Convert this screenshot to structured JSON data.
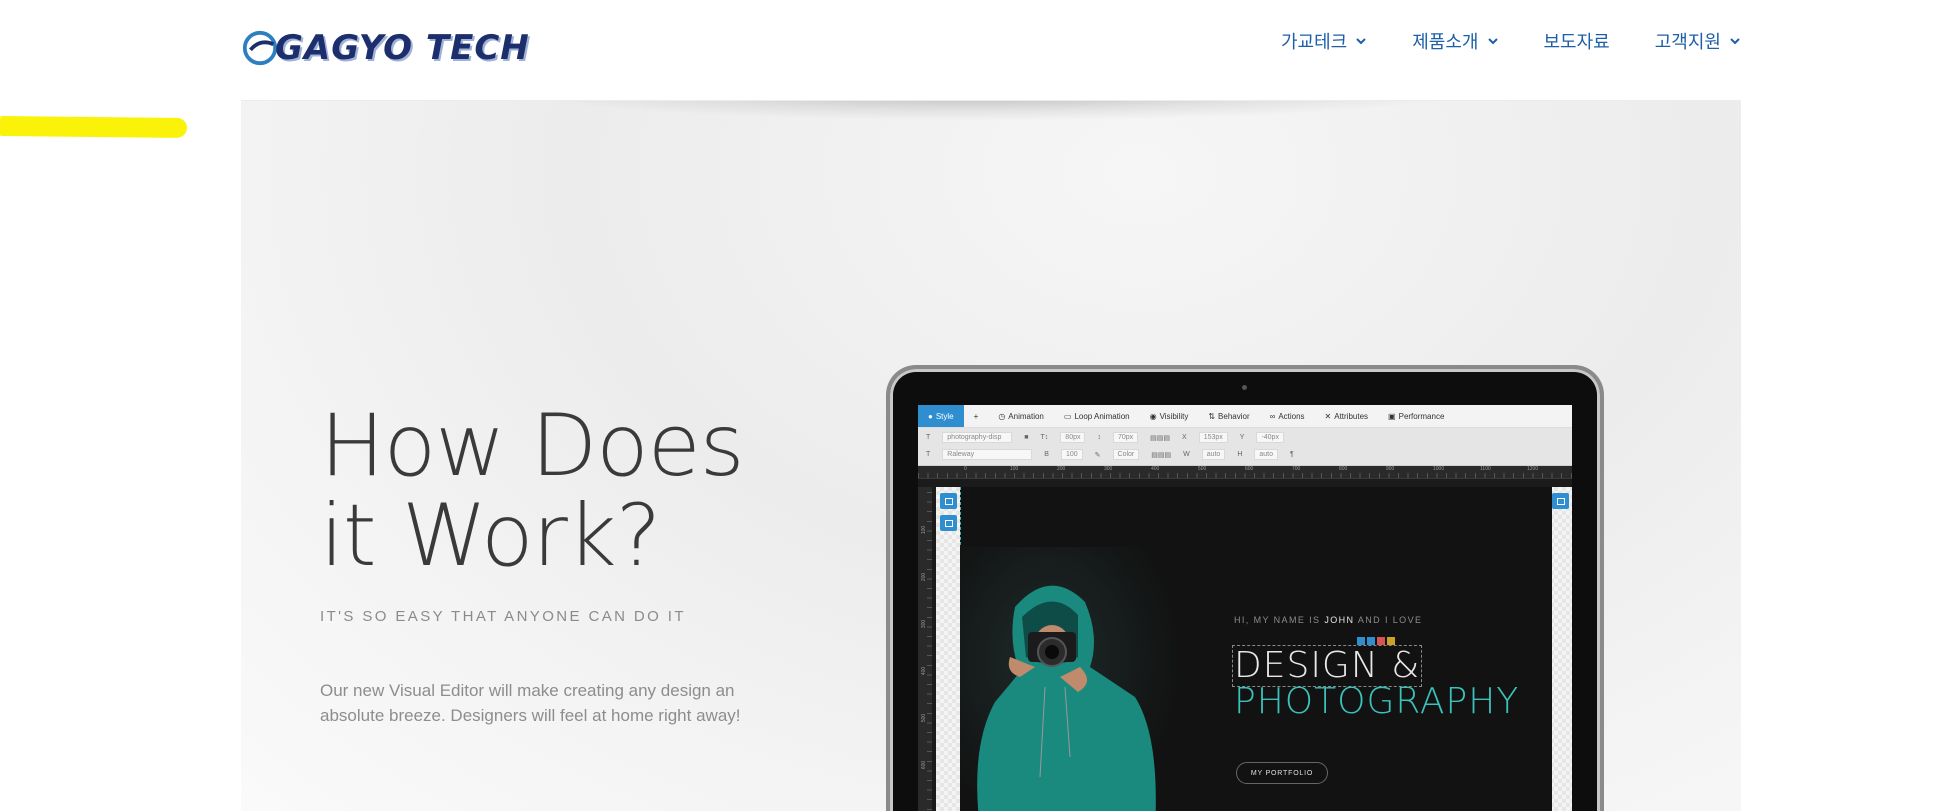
{
  "header": {
    "logo_text": "GAGYO TECH",
    "nav": [
      {
        "label": "가교테크",
        "has_dropdown": true
      },
      {
        "label": "제품소개",
        "has_dropdown": true
      },
      {
        "label": "보도자료",
        "has_dropdown": false
      },
      {
        "label": "고객지원",
        "has_dropdown": true
      }
    ]
  },
  "hero": {
    "title_line1": "How Does",
    "title_line2": "it Work?",
    "subtitle": "IT'S SO EASY THAT ANYONE CAN DO IT",
    "body": "Our new Visual Editor will make creating any design an absolute breeze. Designers will feel at home right away!"
  },
  "editor": {
    "tabs": [
      "Style",
      "+",
      "Animation",
      "Loop Animation",
      "Visibility",
      "Behavior",
      "Actions",
      "Attributes",
      "Performance"
    ],
    "toolbar": {
      "font_class": "photography-disp",
      "font_size": "80px",
      "line_height": "70px",
      "x_value": "153px",
      "y_value": "-40px",
      "font_family": "Raleway",
      "font_weight": "100",
      "color_label": "Color",
      "w_value": "auto",
      "h_value": "auto"
    },
    "ruler_h": [
      "0",
      "100",
      "200",
      "300",
      "400",
      "500",
      "600",
      "700",
      "800",
      "900",
      "1000",
      "1100",
      "1200"
    ],
    "ruler_v": [
      "100",
      "200",
      "300",
      "400",
      "500",
      "600"
    ],
    "canvas": {
      "hi_prefix": "HI, MY NAME IS ",
      "hi_name": "JOHN",
      "hi_suffix": " AND I LOVE",
      "line1": "DESIGN &",
      "line2": "PHOTOGRAPHY",
      "button": "MY PORTFOLIO"
    }
  },
  "colors": {
    "nav": "#1d5fa8",
    "logo": "#1c2f6c",
    "accent_teal": "#3bc2bb",
    "editor_blue": "#2e8ecf",
    "highlight": "#fbf20a"
  }
}
